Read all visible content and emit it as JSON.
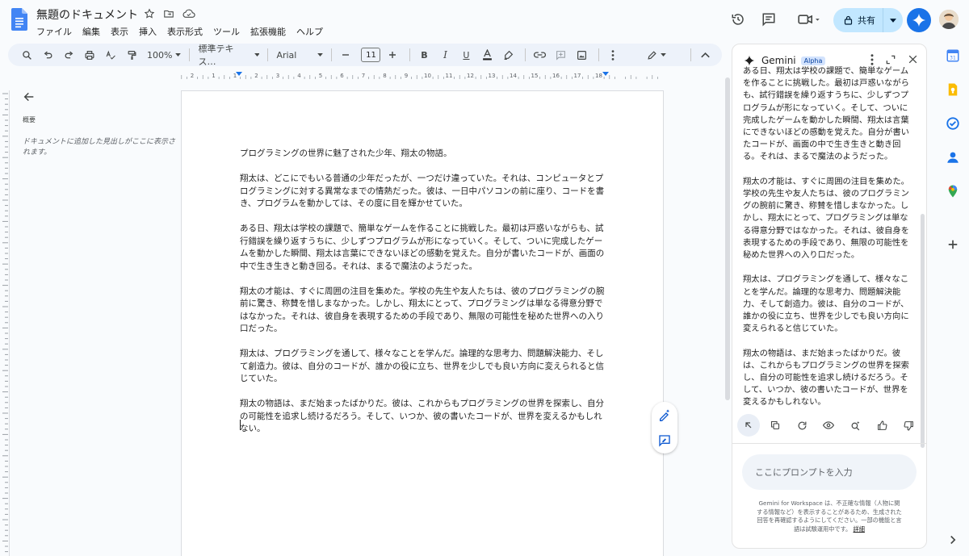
{
  "titlebar": {
    "doc_title": "無題のドキュメント",
    "menu": [
      "ファイル",
      "編集",
      "表示",
      "挿入",
      "表示形式",
      "ツール",
      "拡張機能",
      "ヘルプ"
    ]
  },
  "header_right": {
    "share_label": "共有"
  },
  "toolbar": {
    "zoom": "100%",
    "style": "標準テキス…",
    "font": "Arial",
    "font_size": "11"
  },
  "ruler": {
    "ticks": [
      "2",
      "1",
      "1",
      "2",
      "3",
      "4",
      "5",
      "6",
      "7",
      "8",
      "9",
      "10",
      "11",
      "12",
      "13",
      "14",
      "15",
      "16",
      "17",
      "18"
    ]
  },
  "outline": {
    "label": "概要",
    "hint": "ドキュメントに追加した見出しがここに表示されます。"
  },
  "document": {
    "paragraphs": [
      "プログラミングの世界に魅了された少年、翔太の物語。",
      "翔太は、どこにでもいる普通の少年だったが、一つだけ違っていた。それは、コンピュータとプログラミングに対する異常なまでの情熱だった。彼は、一日中パソコンの前に座り、コードを書き、プログラムを動かしては、その度に目を輝かせていた。",
      "ある日、翔太は学校の課題で、簡単なゲームを作ることに挑戦した。最初は戸惑いながらも、試行錯誤を繰り返すうちに、少しずつプログラムが形になっていく。そして、ついに完成したゲームを動かした瞬間、翔太は言葉にできないほどの感動を覚えた。自分が書いたコードが、画面の中で生き生きと動き回る。それは、まるで魔法のようだった。",
      "翔太の才能は、すぐに周囲の注目を集めた。学校の先生や友人たちは、彼のプログラミングの腕前に驚き、称賛を惜しまなかった。しかし、翔太にとって、プログラミングは単なる得意分野ではなかった。それは、彼自身を表現するための手段であり、無限の可能性を秘めた世界への入り口だった。",
      "翔太は、プログラミングを通して、様々なことを学んだ。論理的な思考力、問題解決能力、そして創造力。彼は、自分のコードが、誰かの役に立ち、世界を少しでも良い方向に変えられると信じていた。",
      "翔太の物語は、まだ始まったばかりだ。彼は、これからもプログラミングの世界を探索し、自分の可能性を追求し続けるだろう。そして、いつか、彼の書いたコードが、世界を変えるかもしれない。"
    ]
  },
  "gemini": {
    "title": "Gemini",
    "badge": "Alpha",
    "response": [
      "ある日、翔太は学校の課題で、簡単なゲームを作ることに挑戦した。最初は戸惑いながらも、試行錯誤を繰り返すうちに、少しずつプログラムが形になっていく。そして、ついに完成したゲームを動かした瞬間、翔太は言葉にできないほどの感動を覚えた。自分が書いたコードが、画面の中で生き生きと動き回る。それは、まるで魔法のようだった。",
      "翔太の才能は、すぐに周囲の注目を集めた。学校の先生や友人たちは、彼のプログラミングの腕前に驚き、称賛を惜しまなかった。しかし、翔太にとって、プログラミングは単なる得意分野ではなかった。それは、彼自身を表現するための手段であり、無限の可能性を秘めた世界への入り口だった。",
      "翔太は、プログラミングを通して、様々なことを学んだ。論理的な思考力、問題解決能力、そして創造力。彼は、自分のコードが、誰かの役に立ち、世界を少しでも良い方向に変えられると信じていた。",
      "翔太の物語は、まだ始まったばかりだ。彼は、これからもプログラミングの世界を探索し、自分の可能性を追求し続けるだろう。そして、いつか、彼の書いたコードが、世界を変えるかもしれない。"
    ],
    "prompt_placeholder": "ここにプロンプトを入力",
    "disclaimer": "Gemini for Workspace は、不正確な情報（人物に関する情報など）を表示することがあるため、生成された回答を再確認するようにしてください。一部の機能と言語は試験運用中です。",
    "disclaimer_link": "詳細"
  },
  "colors": {
    "accent": "#1a73e8",
    "share_bg": "#c2e7ff",
    "toolbar_bg": "#edf2fa",
    "app_bg": "#f9fbfd"
  }
}
